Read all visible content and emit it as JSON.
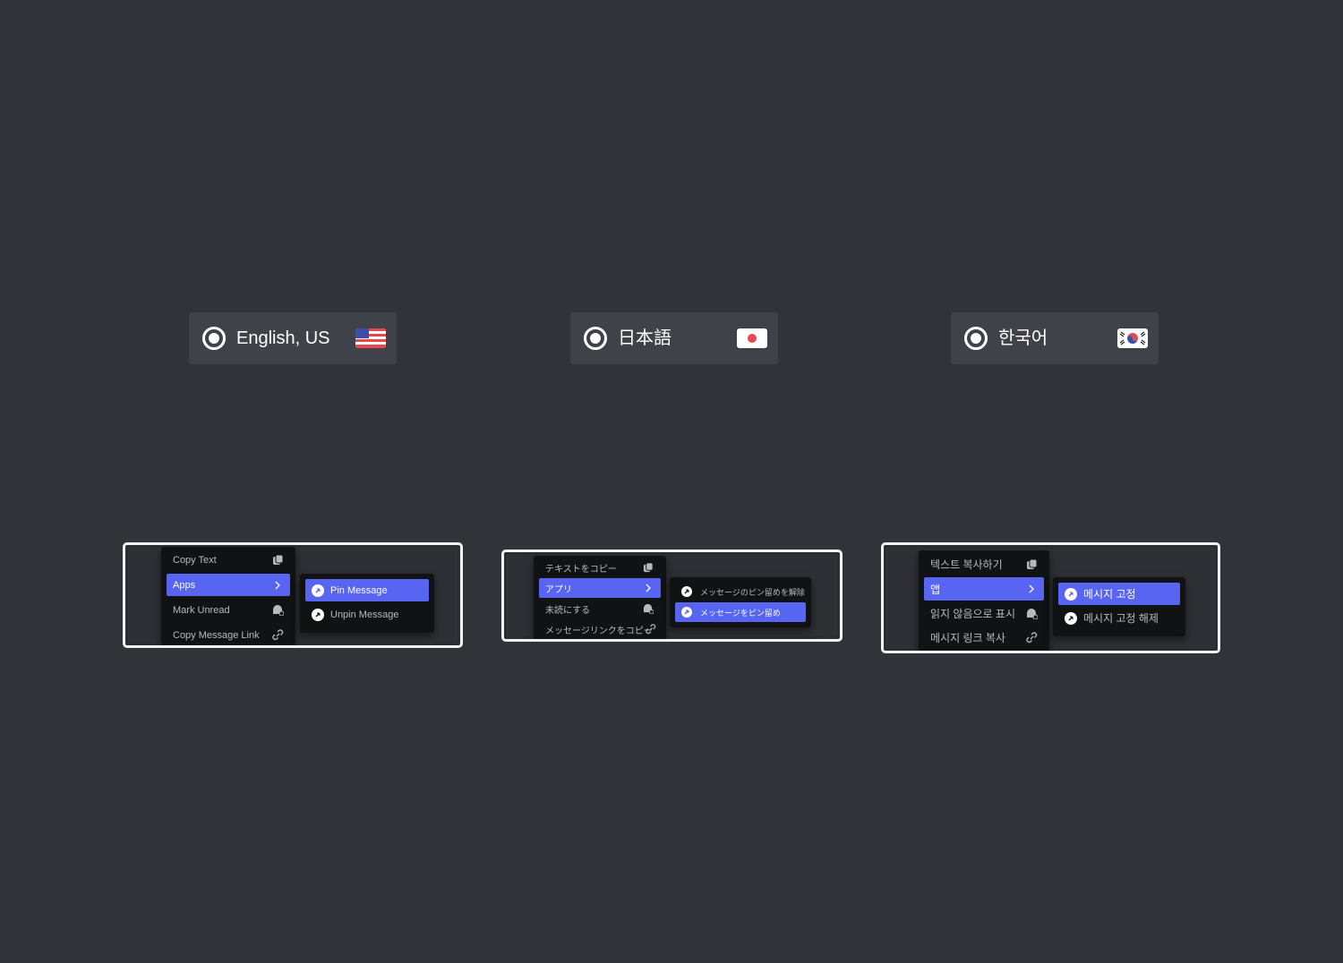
{
  "languages": [
    {
      "label": "English, US",
      "flag": "us-flag-icon",
      "selected": true
    },
    {
      "label": "日本語",
      "flag": "jp-flag-icon",
      "selected": true
    },
    {
      "label": "한국어",
      "flag": "kr-flag-icon",
      "selected": true
    }
  ],
  "menus": {
    "en": {
      "items": [
        "Copy Text",
        "Apps",
        "Mark Unread",
        "Copy Message Link"
      ],
      "submenu": [
        "Pin Message",
        "Unpin Message"
      ]
    },
    "ja": {
      "items": [
        "テキストをコピー",
        "アプリ",
        "未読にする",
        "メッセージリンクをコピー"
      ],
      "submenu": [
        "メッセージのピン留めを解除",
        "メッセージをピン留め"
      ]
    },
    "ko": {
      "items": [
        "텍스트 복사하기",
        "앱",
        "읽지 않음으로 표시",
        "메시지 링크 복사"
      ],
      "submenu": [
        "메시지 고정",
        "메시지 고정 해제"
      ]
    }
  },
  "colors": {
    "background": "#313338",
    "pill": "#404249",
    "accent": "#5865f2",
    "menu": "#111214"
  }
}
